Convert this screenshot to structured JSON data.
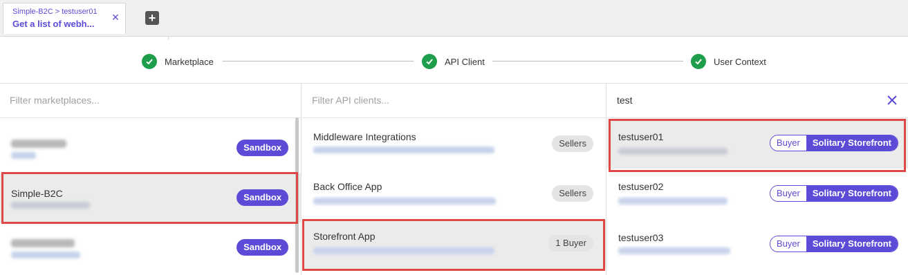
{
  "tab": {
    "breadcrumb": "Simple-B2C > testuser01",
    "title": "Get a list of webh...",
    "close": "×",
    "add": "+"
  },
  "steps": [
    {
      "label": "Marketplace"
    },
    {
      "label": "API Client"
    },
    {
      "label": "User Context"
    }
  ],
  "marketplaces": {
    "placeholder": "Filter marketplaces...",
    "items": [
      {
        "name": "",
        "badge": "Sandbox"
      },
      {
        "name": "Simple-B2C",
        "badge": "Sandbox"
      },
      {
        "name": "",
        "badge": "Sandbox"
      }
    ]
  },
  "api_clients": {
    "placeholder": "Filter API clients...",
    "items": [
      {
        "name": "Middleware Integrations",
        "badge": "Sellers"
      },
      {
        "name": "Back Office App",
        "badge": "Sellers"
      },
      {
        "name": "Storefront App",
        "badge": "1 Buyer"
      }
    ]
  },
  "users": {
    "search_value": "test",
    "items": [
      {
        "name": "testuser01",
        "role1": "Buyer",
        "role2": "Solitary Storefront"
      },
      {
        "name": "testuser02",
        "role1": "Buyer",
        "role2": "Solitary Storefront"
      },
      {
        "name": "testuser03",
        "role1": "Buyer",
        "role2": "Solitary Storefront"
      }
    ]
  },
  "colors": {
    "accent": "#5b4bd6",
    "success": "#1e9e4a",
    "highlight": "#e04848"
  }
}
